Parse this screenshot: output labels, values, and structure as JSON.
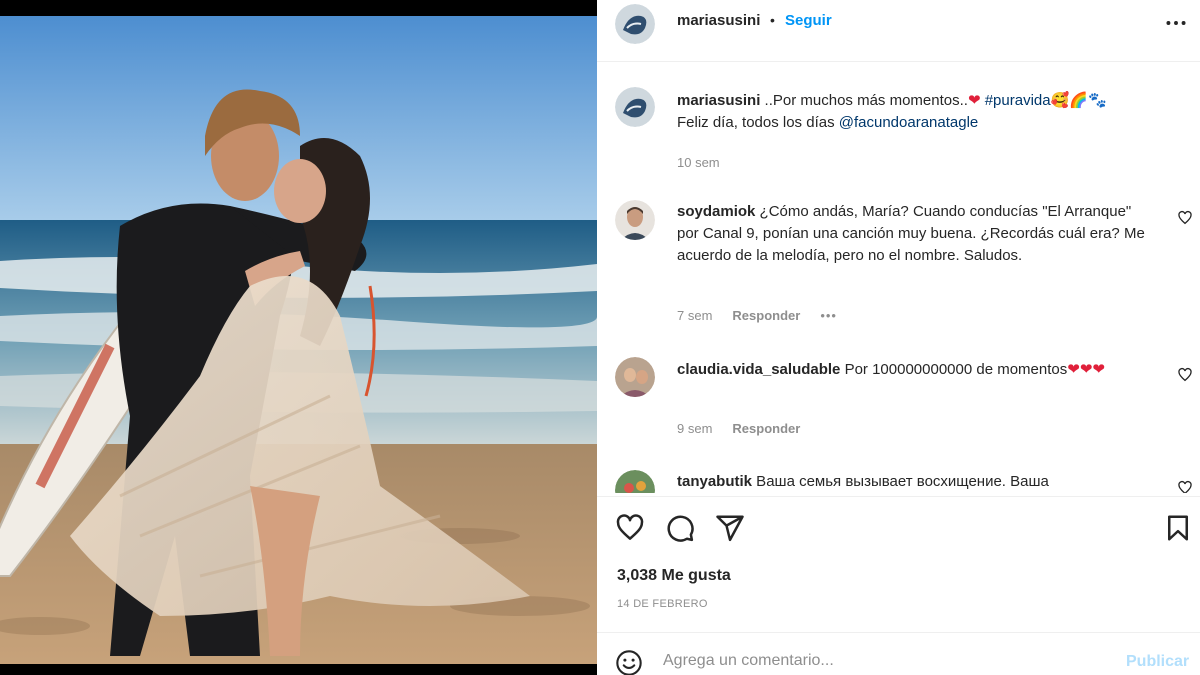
{
  "post": {
    "author": "mariasusini",
    "separator": "•",
    "follow_label": "Seguir",
    "more_icon": "more-horizontal-icon"
  },
  "caption": {
    "user": "mariasusini",
    "text_1": " ..Por muchos más momentos..",
    "heart_emoji": "❤",
    "hashtag": "#puravida",
    "trailing_emoji": "🥰🌈🐾",
    "text_2": "Feliz día, todos los días ",
    "mention": "@facundoaranatagle",
    "time": "10 sem"
  },
  "comments": [
    {
      "user": "soydamiok",
      "text": " ¿Cómo andás, María? Cuando conducías \"El Arranque\" por Canal 9, ponían una canción muy buena. ¿Recordás cuál era? Me acuerdo de la melodía, pero no el nombre. Saludos.",
      "time": "7 sem",
      "reply_label": "Responder",
      "more": "•••"
    },
    {
      "user": "claudia.vida_saludable",
      "text": " Por 100000000000 de momentos",
      "hearts": "❤❤❤",
      "time": "9 sem",
      "reply_label": "Responder"
    },
    {
      "user": "tanyabutik",
      "text": " Ваша семья вызывает восхищение. Ваша"
    }
  ],
  "actions": {
    "icons": [
      "heart-icon",
      "comment-icon",
      "share-icon",
      "bookmark-icon"
    ],
    "likes": "3,038 Me gusta",
    "date": "14 DE FEBRERO"
  },
  "add_comment": {
    "placeholder": "Agrega un comentario...",
    "publish_label": "Publicar"
  },
  "colors": {
    "accent": "#0095f6",
    "link": "#00376b",
    "muted": "#8e8e8e",
    "publish_disabled": "#b2dffc"
  }
}
